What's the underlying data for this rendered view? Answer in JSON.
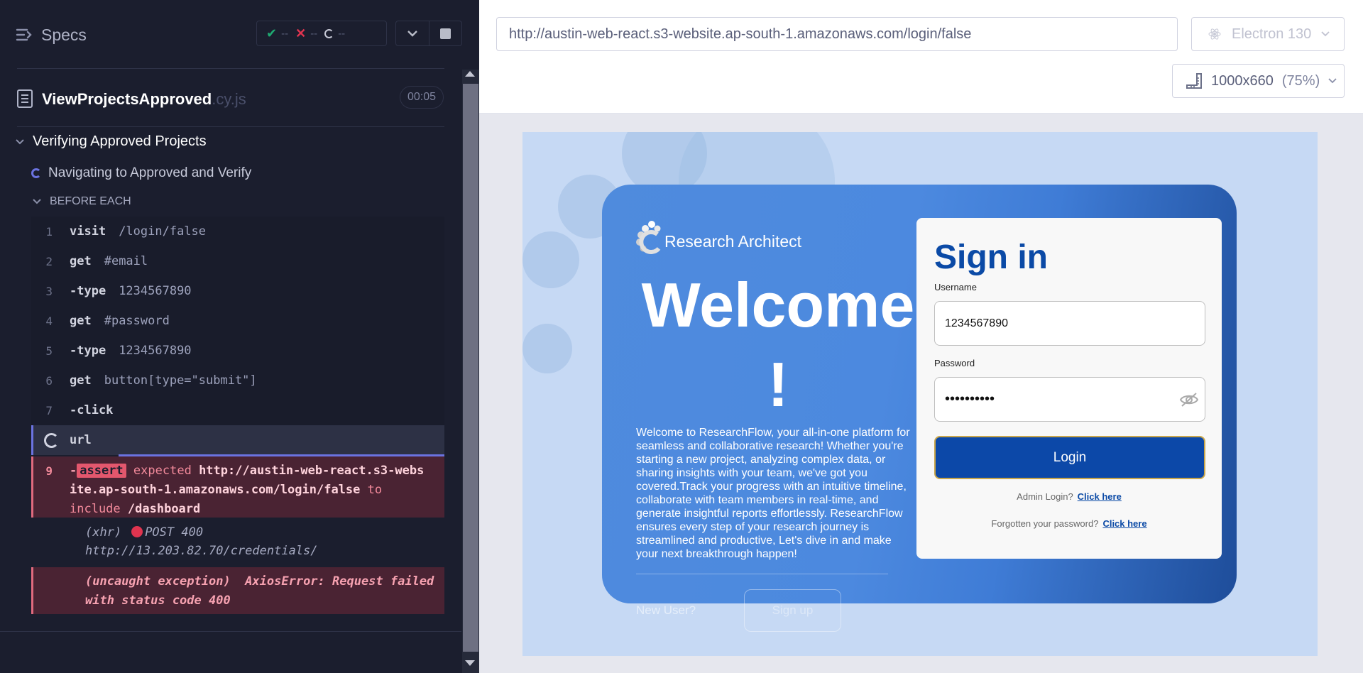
{
  "reporter": {
    "specs_label": "Specs",
    "stats": {
      "passed": "--",
      "failed": "--",
      "pending": "--"
    },
    "file": {
      "name": "ViewProjectsApproved",
      "ext": ".cy.js",
      "duration": "00:05"
    },
    "suite_title": "Verifying Approved Projects",
    "test_title": "Navigating to Approved and Verify",
    "hook_title": "BEFORE EACH",
    "commands": [
      {
        "num": "1",
        "name": "visit",
        "arg": "/login/false"
      },
      {
        "num": "2",
        "name": "get",
        "arg": "#email"
      },
      {
        "num": "3",
        "name": "-type",
        "arg": "1234567890"
      },
      {
        "num": "4",
        "name": "get",
        "arg": "#password"
      },
      {
        "num": "5",
        "name": "-type",
        "arg": "1234567890"
      },
      {
        "num": "6",
        "name": "get",
        "arg": "button[type=\"submit\"]"
      },
      {
        "num": "7",
        "name": "-click",
        "arg": ""
      },
      {
        "num": "",
        "name": "url",
        "arg": ""
      }
    ],
    "failed_command": {
      "num": "9",
      "dash": "-",
      "keyword": "assert",
      "expected": "expected",
      "actual": "http://austin-web-react.s3-website.ap-south-1.amazonaws.com/login/false",
      "to_include": "to include",
      "target": "/dashboard"
    },
    "xhr": {
      "label": "(xhr)",
      "method": "POST 400",
      "url": "http://13.203.82.70/credentials/"
    },
    "exception": {
      "label": "(uncaught exception)",
      "message": "AxiosError: Request failed with status code 400"
    }
  },
  "browser": {
    "url": "http://austin-web-react.s3-website.ap-south-1.amazonaws.com/login/false",
    "name": "Electron 130",
    "viewport": "1000x660",
    "scale": "(75%)"
  },
  "app": {
    "logo_text": "Research Architect",
    "welcome_title": "Welcome !",
    "welcome_text": "Welcome to ResearchFlow, your all-in-one platform for seamless and collaborative research! Whether you're starting a new project, analyzing complex data, or sharing insights with your team, we've got you covered.Track your progress with an intuitive timeline, collaborate with team members in real-time, and generate insightful reports effortlessly. ResearchFlow ensures every step of your research journey is streamlined and productive, Let's dive in and make your next breakthrough happen!",
    "new_user_label": "New User?",
    "signup_label": "Sign up",
    "signin_title": "Sign in",
    "username_label": "Username",
    "username_value": "1234567890",
    "password_label": "Password",
    "password_value": "••••••••••",
    "login_label": "Login",
    "admin_label": "Admin Login?",
    "admin_link": "Click here",
    "forgot_label": "Forgotten your password?",
    "forgot_link": "Click here"
  },
  "colors": {
    "accent": "#6b73e0",
    "fail": "#e06a7e",
    "brand": "#0c48a8"
  }
}
